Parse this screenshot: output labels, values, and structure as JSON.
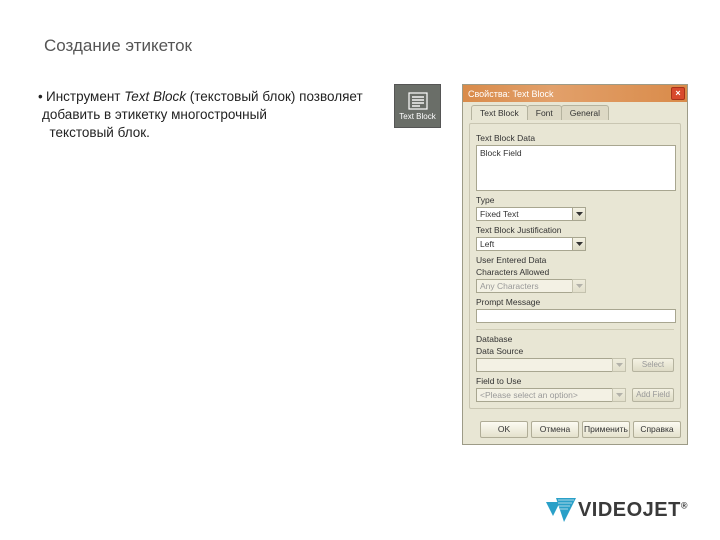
{
  "page": {
    "title": "Создание этикеток",
    "bulletText": {
      "prefix": "Инструмент ",
      "italic": "Text Block",
      "middle": " (текстовый блок) позволяет добавить в этикетку многострочный",
      "tail": " текстовый блок."
    }
  },
  "toolIcon": {
    "label": "Text Block"
  },
  "dialog": {
    "title": "Свойства: Text Block",
    "tabs": [
      "Text Block",
      "Font",
      "General"
    ],
    "labels": {
      "textBlockData": "Text Block Data",
      "type": "Type",
      "justification": "Text Block Justification",
      "userEntered": "User Entered Data",
      "charsAllowed": "Characters Allowed",
      "promptMessage": "Prompt Message",
      "database": "Database",
      "dataSource": "Data Source",
      "fieldToUse": "Field to Use"
    },
    "values": {
      "blockText": "Block Field",
      "type": "Fixed Text",
      "justification": "Left",
      "charsAllowed": "Any Characters",
      "promptMessage": "",
      "dataSource": "",
      "fieldToUse": "<Please select an option>"
    },
    "buttons": {
      "select": "Select",
      "addField": "Add Field",
      "ok": "OK",
      "cancel": "Отмена",
      "apply": "Применить",
      "help": "Справка"
    }
  },
  "logo": {
    "text": "VIDEOJET"
  }
}
